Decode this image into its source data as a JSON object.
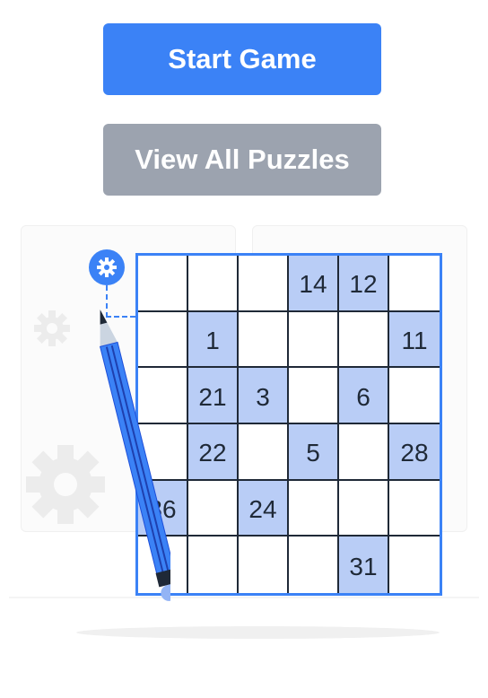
{
  "buttons": {
    "start_label": "Start Game",
    "view_all_label": "View All Puzzles"
  },
  "puzzle": {
    "rows": [
      [
        "",
        "",
        "",
        "14",
        "12",
        ""
      ],
      [
        "",
        "1",
        "",
        "",
        "",
        "11"
      ],
      [
        "",
        "21",
        "3",
        "",
        "6",
        ""
      ],
      [
        "",
        "22",
        "",
        "5",
        "",
        "28"
      ],
      [
        "36",
        "",
        "24",
        "",
        "",
        ""
      ],
      [
        "",
        "",
        "",
        "",
        "31",
        ""
      ]
    ]
  },
  "colors": {
    "accent": "#3b82f6",
    "secondary": "#9ca3af",
    "cell_fill": "#b9cdf6",
    "grid_line": "#1f2937"
  },
  "icons": [
    "gear-icon",
    "pencil-icon"
  ]
}
